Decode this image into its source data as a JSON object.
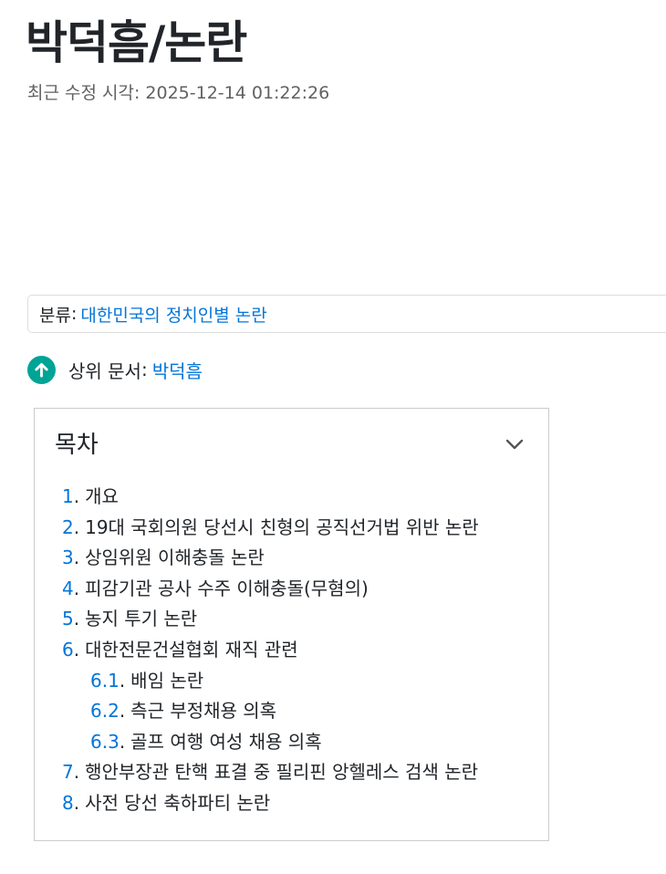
{
  "page": {
    "title": "박덕흠/논란",
    "last_modified": "최근 수정 시각: 2025-12-14 01:22:26"
  },
  "category": {
    "label": "분류",
    "separator": ":",
    "link": "대한민국의 정치인별 논란"
  },
  "parent": {
    "icon": "arrow-up-circle-icon",
    "label": "상위 문서",
    "separator": ":",
    "link": "박덕흠"
  },
  "toc": {
    "title": "목차",
    "toggle_icon": "chevron-down-icon",
    "items": [
      {
        "num": "1",
        "text": "개요",
        "level": 1
      },
      {
        "num": "2",
        "text": "19대 국회의원 당선시 친형의 공직선거법 위반 논란",
        "level": 1
      },
      {
        "num": "3",
        "text": "상임위원 이해충돌 논란",
        "level": 1
      },
      {
        "num": "4",
        "text": "피감기관 공사 수주 이해충돌(무혐의)",
        "level": 1
      },
      {
        "num": "5",
        "text": "농지 투기 논란",
        "level": 1
      },
      {
        "num": "6",
        "text": "대한전문건설협회 재직 관련",
        "level": 1
      },
      {
        "num": "6.1",
        "text": "배임 논란",
        "level": 2
      },
      {
        "num": "6.2",
        "text": "측근 부정채용 의혹",
        "level": 2
      },
      {
        "num": "6.3",
        "text": "골프 여행 여성 채용 의혹",
        "level": 2
      },
      {
        "num": "7",
        "text": "행안부장관 탄핵 표결 중 필리핀 앙헬레스 검색 논란",
        "level": 1
      },
      {
        "num": "8",
        "text": "사전 당선 축하파티 논란",
        "level": 1
      }
    ]
  },
  "colors": {
    "link": "#0275d8",
    "accent_green": "#00a495",
    "text": "#212529",
    "muted": "#616161"
  }
}
